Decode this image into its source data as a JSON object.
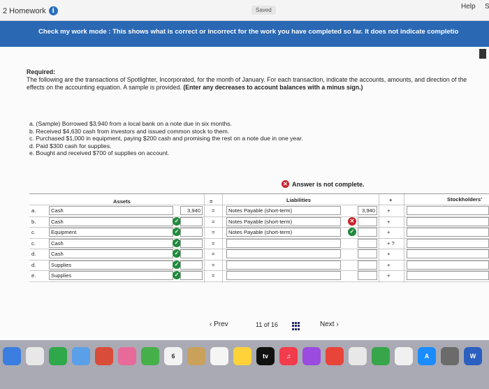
{
  "topbar": {
    "homework_label": "2 Homework",
    "saved_label": "Saved",
    "help_label": "Help",
    "extra_label": "S"
  },
  "banner": {
    "text": "Check my work mode : This shows what is correct or incorrect for the work you have completed so far. It does not indicate completio"
  },
  "required": {
    "title": "Required:",
    "body": "The following are the transactions of Spotlighter, Incorporated, for the month of January. For each transaction, indicate the accounts, amounts, and direction of the effects on the accounting equation. A sample is provided.",
    "emphasis": "(Enter any decreases to account balances with a minus sign.)"
  },
  "transactions": [
    "a. (Sample) Borrowed $3,940 from a local bank on a note due in six months.",
    "b. Received $4,630 cash from investors and issued common stock to them.",
    "c. Purchased $1,000 in equipment, paying $200 cash and promising the rest on a note due in one year.",
    "d. Paid $300 cash for supplies.",
    "e. Bought and received $700 of supplies on account."
  ],
  "status": {
    "text": "Answer is not complete."
  },
  "table": {
    "headers": {
      "assets": "Assets",
      "eq": "=",
      "liabilities": "Liabilities",
      "plus": "+",
      "equity": "Stockholders'"
    },
    "rows": [
      {
        "letter": "a.",
        "asset": "Cash",
        "amount": "3,940",
        "eq": "=",
        "liability": "Notes Payable (short-term)",
        "liab_amount": "3,940",
        "plus": "+"
      },
      {
        "letter": "b.",
        "asset": "Cash",
        "amount": "",
        "eq": "=",
        "liability": "Notes Payable (short-term)",
        "liab_amount": "",
        "plus": "+"
      },
      {
        "letter": "c.",
        "asset": "Equipment",
        "amount": "",
        "eq": "=",
        "liability": "Notes Payable (short-term)",
        "liab_amount": "",
        "plus": "+"
      },
      {
        "letter": "c.",
        "asset": "Cash",
        "amount": "",
        "eq": "=",
        "liability": "",
        "liab_amount": "",
        "plus": "+ ?"
      },
      {
        "letter": "d.",
        "asset": "Cash",
        "amount": "",
        "eq": "=",
        "liability": "",
        "liab_amount": "",
        "plus": "+"
      },
      {
        "letter": "d.",
        "asset": "Supplies",
        "amount": "",
        "eq": "=",
        "liability": "",
        "liab_amount": "",
        "plus": "+"
      },
      {
        "letter": "e.",
        "asset": "Supplies",
        "amount": "",
        "eq": "=",
        "liability": "",
        "liab_amount": "",
        "plus": "+"
      }
    ],
    "check_icon": "✓",
    "x_icon": "✕"
  },
  "pager": {
    "prev": "Prev",
    "page": "11",
    "of": "of",
    "total": "16",
    "next": "Next"
  },
  "dock": {
    "apps": [
      {
        "name": "app-icon-1",
        "label": "",
        "color": "#3b7de0"
      },
      {
        "name": "app-icon-2",
        "label": "",
        "color": "#e8e8e8"
      },
      {
        "name": "app-icon-3",
        "label": "",
        "color": "#2ea84a"
      },
      {
        "name": "app-icon-4",
        "label": "",
        "color": "#5aa0e8"
      },
      {
        "name": "app-icon-5",
        "label": "",
        "color": "#d94c3a"
      },
      {
        "name": "app-icon-6",
        "label": "",
        "color": "#e86a9a"
      },
      {
        "name": "app-icon-7",
        "label": "",
        "color": "#45b04a"
      },
      {
        "name": "app-icon-8",
        "label": "6",
        "color": "#f2f2f2"
      },
      {
        "name": "app-icon-9",
        "label": "",
        "color": "#c9a15b"
      },
      {
        "name": "app-icon-10",
        "label": "",
        "color": "#f5f5f5"
      },
      {
        "name": "app-icon-11",
        "label": "",
        "color": "#ffd23a"
      },
      {
        "name": "app-icon-12",
        "label": "tv",
        "color": "#111111"
      },
      {
        "name": "app-icon-13",
        "label": "♫",
        "color": "#f23b4b"
      },
      {
        "name": "app-icon-14",
        "label": "",
        "color": "#9b4be0"
      },
      {
        "name": "app-icon-15",
        "label": "",
        "color": "#e8443a"
      },
      {
        "name": "app-icon-16",
        "label": "",
        "color": "#e8e8e8"
      },
      {
        "name": "app-icon-17",
        "label": "",
        "color": "#37a64b"
      },
      {
        "name": "app-icon-18",
        "label": "",
        "color": "#f0f0f0"
      },
      {
        "name": "app-icon-19",
        "label": "A",
        "color": "#1a8cff"
      },
      {
        "name": "app-icon-20",
        "label": "",
        "color": "#6b6b6b"
      },
      {
        "name": "app-icon-21",
        "label": "W",
        "color": "#2b5fc0"
      }
    ]
  }
}
